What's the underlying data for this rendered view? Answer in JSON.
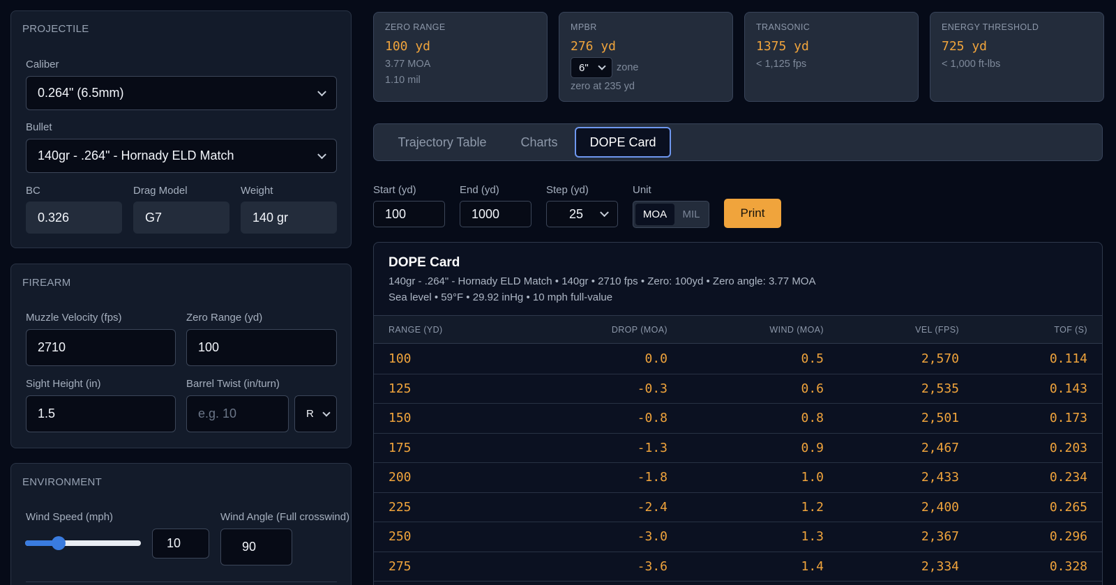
{
  "projectile": {
    "title": "PROJECTILE",
    "caliber_label": "Caliber",
    "caliber_value": "0.264\" (6.5mm)",
    "bullet_label": "Bullet",
    "bullet_value": "140gr - .264\" - Hornady ELD Match",
    "bc_label": "BC",
    "bc_value": "0.326",
    "drag_label": "Drag Model",
    "drag_value": "G7",
    "weight_label": "Weight",
    "weight_value": "140 gr"
  },
  "firearm": {
    "title": "FIREARM",
    "mv_label": "Muzzle Velocity (fps)",
    "mv_value": "2710",
    "zero_label": "Zero Range (yd)",
    "zero_value": "100",
    "sight_label": "Sight Height (in)",
    "sight_value": "1.5",
    "twist_label": "Barrel Twist (in/turn)",
    "twist_placeholder": "e.g. 10",
    "twist_dir": "R"
  },
  "environment": {
    "title": "ENVIRONMENT",
    "wind_speed_label": "Wind Speed (mph)",
    "wind_speed_value": "10",
    "wind_slider_fraction": 0.29,
    "wind_angle_label": "Wind Angle (Full crosswind)",
    "wind_angle_value": "90"
  },
  "stats": {
    "zero": {
      "title": "ZERO RANGE",
      "value": "100 yd",
      "sub1": "3.77 MOA",
      "sub2": "1.10 mil"
    },
    "mpbr": {
      "title": "MPBR",
      "value": "276 yd",
      "zone_select": "6\"",
      "zone_label": "zone",
      "sub2": "zero at 235 yd"
    },
    "transonic": {
      "title": "TRANSONIC",
      "value": "1375 yd",
      "sub1": "< 1,125 fps"
    },
    "energy": {
      "title": "ENERGY THRESHOLD",
      "value": "725 yd",
      "sub1": "< 1,000 ft-lbs"
    }
  },
  "tabs": [
    {
      "label": "Trajectory Table",
      "active": false
    },
    {
      "label": "Charts",
      "active": false
    },
    {
      "label": "DOPE Card",
      "active": true
    }
  ],
  "controls": {
    "start_label": "Start (yd)",
    "start_value": "100",
    "end_label": "End (yd)",
    "end_value": "1000",
    "step_label": "Step (yd)",
    "step_value": "25",
    "unit_label": "Unit",
    "unit_options": [
      "MOA",
      "MIL"
    ],
    "unit_selected": "MOA",
    "print_label": "Print"
  },
  "dope": {
    "title": "DOPE Card",
    "line1": "140gr - .264\" - Hornady ELD Match • 140gr • 2710 fps • Zero: 100yd • Zero angle: 3.77 MOA",
    "line2": "Sea level • 59°F • 29.92 inHg • 10 mph full-value",
    "columns": [
      "RANGE (YD)",
      "DROP (MOA)",
      "WIND (MOA)",
      "VEL (FPS)",
      "TOF (S)"
    ],
    "rows": [
      [
        "100",
        "0.0",
        "0.5",
        "2,570",
        "0.114"
      ],
      [
        "125",
        "-0.3",
        "0.6",
        "2,535",
        "0.143"
      ],
      [
        "150",
        "-0.8",
        "0.8",
        "2,501",
        "0.173"
      ],
      [
        "175",
        "-1.3",
        "0.9",
        "2,467",
        "0.203"
      ],
      [
        "200",
        "-1.8",
        "1.0",
        "2,433",
        "0.234"
      ],
      [
        "225",
        "-2.4",
        "1.2",
        "2,400",
        "0.265"
      ],
      [
        "250",
        "-3.0",
        "1.3",
        "2,367",
        "0.296"
      ],
      [
        "275",
        "-3.6",
        "1.4",
        "2,334",
        "0.328"
      ]
    ]
  },
  "colors": {
    "accent": "#f0a43c",
    "background": "#060b18",
    "panel": "#131b2a",
    "active_tab_border": "#6e97ef",
    "slider": "#3a7ce0"
  }
}
